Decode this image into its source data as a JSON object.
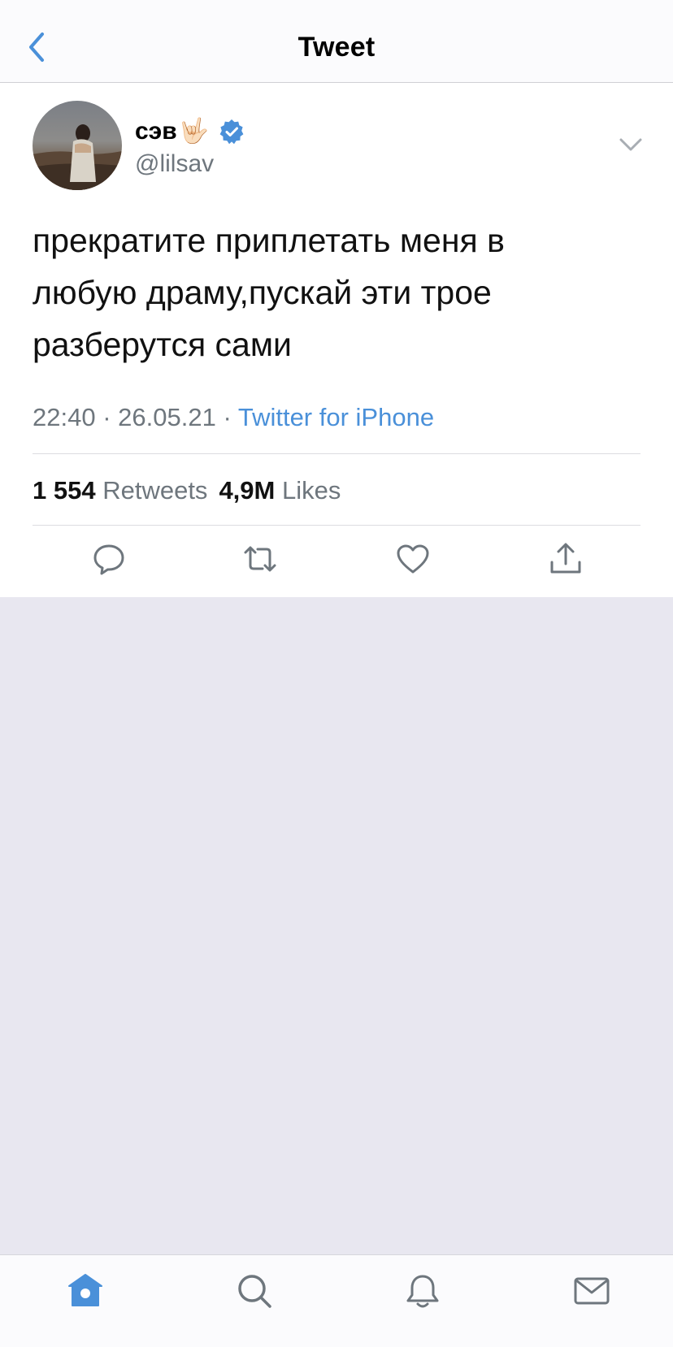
{
  "header": {
    "title": "Tweet"
  },
  "author": {
    "display_name": "сэв",
    "name_emoji": "🤟🏻",
    "handle": "@lilsav",
    "verified": true
  },
  "tweet": {
    "text": "прекратите приплетать меня в\nлюбую драму,пускай эти трое\nразберутся  сами",
    "time": "22:40",
    "date": "26.05.21",
    "separator": "·",
    "source": "Twitter for iPhone"
  },
  "stats": {
    "retweets_count": "1 554",
    "retweets_label": "Retweets",
    "likes_count": "4,9M",
    "likes_label": "Likes"
  },
  "actions": [
    "reply-icon",
    "retweet-icon",
    "like-icon",
    "share-icon"
  ],
  "tabbar": {
    "items": [
      "home-icon",
      "search-icon",
      "notifications-icon",
      "messages-icon"
    ],
    "active": "home-icon"
  },
  "colors": {
    "accent": "#4a90d9",
    "secondary_text": "#6e767d",
    "verified_blue": "#4a90d9",
    "page_background": "#e8e7f0"
  }
}
